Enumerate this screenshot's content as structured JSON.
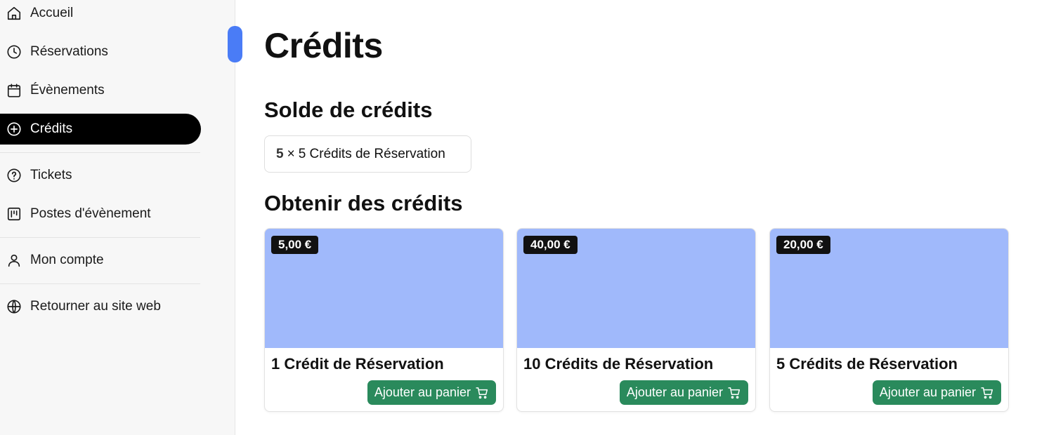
{
  "sidebar": {
    "items": [
      {
        "label": "Accueil",
        "icon": "home-icon"
      },
      {
        "label": "Réservations",
        "icon": "clock-icon"
      },
      {
        "label": "Évènements",
        "icon": "calendar-icon"
      },
      {
        "label": "Crédits",
        "icon": "plus-circle-icon",
        "active": true
      },
      {
        "label": "Tickets",
        "icon": "help-circle-icon"
      },
      {
        "label": "Postes d'évènement",
        "icon": "kanban-icon"
      },
      {
        "label": "Mon compte",
        "icon": "user-icon"
      },
      {
        "label": "Retourner au site web",
        "icon": "globe-icon"
      }
    ]
  },
  "main": {
    "title": "Crédits",
    "balance_title": "Solde de crédits",
    "balance": {
      "quantity": "5",
      "times": "×",
      "label": "5 Crédits de Réservation"
    },
    "obtain_title": "Obtenir des crédits",
    "products": [
      {
        "price": "5,00 €",
        "name": "1 Crédit de Réservation",
        "button": "Ajouter au panier"
      },
      {
        "price": "40,00 €",
        "name": "10 Crédits de Réservation",
        "button": "Ajouter au panier"
      },
      {
        "price": "20,00 €",
        "name": "5 Crédits de Réservation",
        "button": "Ajouter au panier"
      }
    ]
  },
  "colors": {
    "active_nav": "#000000",
    "accent_scroll": "#4a7cf6",
    "card_image": "#a0b9fb",
    "button_green": "#2a8a5c"
  }
}
